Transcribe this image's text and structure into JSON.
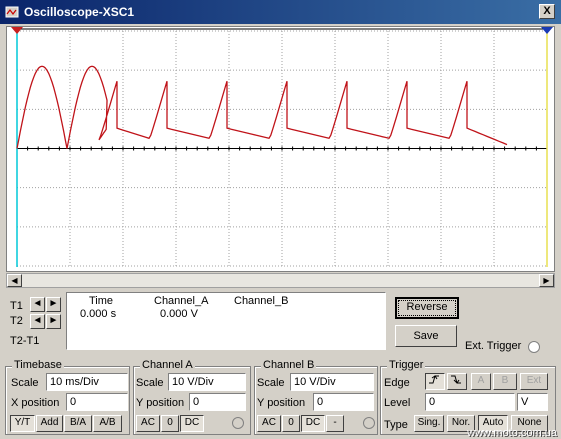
{
  "window": {
    "title": "Oscilloscope-XSC1",
    "close_glyph": "X"
  },
  "icons": {
    "app": "oscilloscope-icon",
    "close": "close-icon"
  },
  "colors": {
    "trace": "#c0141a",
    "grid": "#a0a0a0",
    "cursor_t1": "#00c8d8",
    "cursor_t2": "#e8e050",
    "marker_t1": "#c82020",
    "marker_t2": "#1a3ab4"
  },
  "cursors": {
    "t1_label": "T1",
    "t2_label": "T2",
    "diff_label": "T2-T1",
    "headers": [
      "Time",
      "Channel_A",
      "Channel_B"
    ],
    "row": {
      "time": "0.000 s",
      "channel_a": "0.000 V",
      "channel_b": ""
    }
  },
  "buttons": {
    "reverse": "Reverse",
    "save": "Save",
    "ext_trigger": "Ext. Trigger"
  },
  "timebase": {
    "title": "Timebase",
    "scale_label": "Scale",
    "scale_value": "10 ms/Div",
    "xpos_label": "X position",
    "xpos_value": "0",
    "modes": [
      "Y/T",
      "Add",
      "B/A",
      "A/B"
    ]
  },
  "channel_a": {
    "title": "Channel A",
    "scale_label": "Scale",
    "scale_value": "10  V/Div",
    "ypos_label": "Y position",
    "ypos_value": "0",
    "coupling": [
      "AC",
      "0",
      "DC"
    ]
  },
  "channel_b": {
    "title": "Channel B",
    "scale_label": "Scale",
    "scale_value": "10  V/Div",
    "ypos_label": "Y position",
    "ypos_value": "0",
    "coupling": [
      "AC",
      "0",
      "DC",
      "-"
    ]
  },
  "trigger": {
    "title": "Trigger",
    "edge_label": "Edge",
    "edge_rise": "rising-edge-icon",
    "edge_fall": "falling-edge-icon",
    "sources": [
      "A",
      "B",
      "Ext"
    ],
    "level_label": "Level",
    "level_value": "0",
    "level_unit": "V",
    "type_label": "Type",
    "types": [
      "Sing.",
      "Nor.",
      "Auto",
      "None"
    ]
  },
  "watermark": "www.moto.com.ua"
}
